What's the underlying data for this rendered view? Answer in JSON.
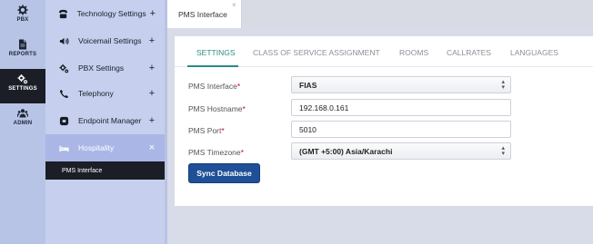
{
  "rail": {
    "items": [
      {
        "label": "PBX",
        "icon": "gear-icon"
      },
      {
        "label": "REPORTS",
        "icon": "document-icon"
      },
      {
        "label": "SETTINGS",
        "icon": "gears-icon"
      },
      {
        "label": "ADMIN",
        "icon": "users-icon"
      }
    ]
  },
  "submenu": {
    "items": [
      {
        "label": "Technology Settings",
        "toggle": "+",
        "icon": "phone-desk-icon"
      },
      {
        "label": "Voicemail Settings",
        "toggle": "+",
        "icon": "voicemail-icon"
      },
      {
        "label": "PBX Settings",
        "toggle": "+",
        "icon": "gears-icon"
      },
      {
        "label": "Telephony",
        "toggle": "+",
        "icon": "phone-icon"
      },
      {
        "label": "Endpoint Manager",
        "toggle": "+",
        "icon": "endpoint-icon"
      },
      {
        "label": "Hospitality",
        "toggle": "×",
        "icon": "bed-icon"
      }
    ],
    "child": "PMS Interface"
  },
  "tabstrip": {
    "tab_label": "PMS Interface",
    "close": "×"
  },
  "nav": {
    "tabs": [
      {
        "label": "SETTINGS"
      },
      {
        "label": "CLASS OF SERVICE ASSIGNMENT"
      },
      {
        "label": "ROOMS"
      },
      {
        "label": "CALLRATES"
      },
      {
        "label": "LANGUAGES"
      }
    ],
    "active_color": "#2c8a83"
  },
  "form": {
    "interface": {
      "label": "PMS Interface",
      "required": "*",
      "value": "FIAS"
    },
    "hostname": {
      "label": "PMS Hostname",
      "required": "*",
      "value": "192.168.0.161"
    },
    "port": {
      "label": "PMS Port",
      "required": "*",
      "value": "5010"
    },
    "timezone": {
      "label": "PMS Timezone",
      "required": "*",
      "value": "(GMT +5:00) Asia/Karachi"
    },
    "sync_button": "Sync Database"
  },
  "colors": {
    "rail_bg": "#b7c4e6",
    "submenu_bg": "#c6d0ee",
    "active_dark": "#1b1e26",
    "button": "#1f4f97"
  }
}
